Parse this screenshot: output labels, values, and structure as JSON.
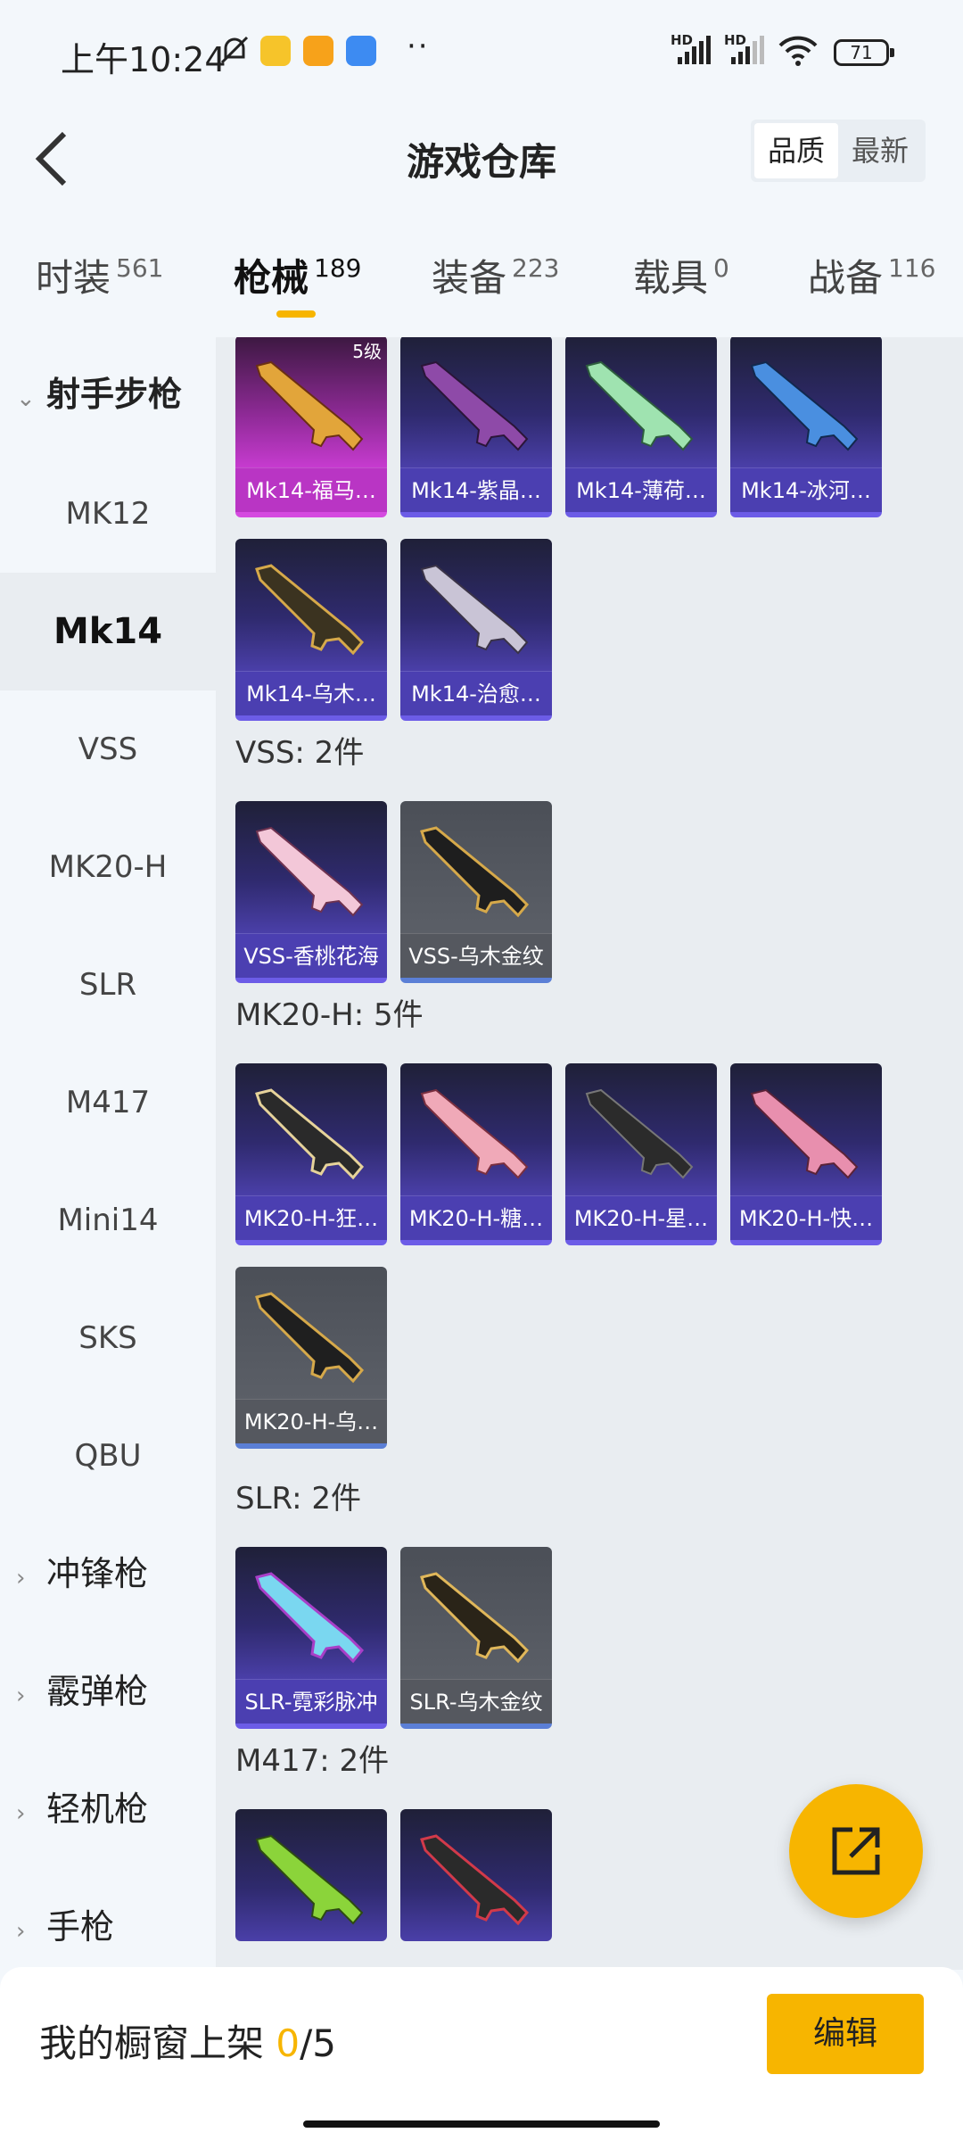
{
  "status": {
    "time": "上午10:24",
    "battery": "71",
    "dots": "··",
    "signal1_label": "HD",
    "signal2_label": "HD"
  },
  "header": {
    "title": "游戏仓库",
    "sort_quality": "品质",
    "sort_latest": "最新"
  },
  "tabs": [
    {
      "label": "时装",
      "count": "561"
    },
    {
      "label": "枪械",
      "count": "189"
    },
    {
      "label": "装备",
      "count": "223"
    },
    {
      "label": "载具",
      "count": "0"
    },
    {
      "label": "战备",
      "count": "116"
    }
  ],
  "sidebar": {
    "open_category": "射手步枪",
    "items": [
      "MK12",
      "Mk14",
      "VSS",
      "MK20-H",
      "SLR",
      "M417",
      "Mini14",
      "SKS",
      "QBU"
    ],
    "categories": [
      "冲锋枪",
      "霰弹枪",
      "轻机枪",
      "手枪"
    ]
  },
  "sections": {
    "mk14": {
      "cards": [
        "Mk14-福马…",
        "Mk14-紫晶…",
        "Mk14-薄荷…",
        "Mk14-冰河…",
        "Mk14-乌木…",
        "Mk14-治愈…"
      ],
      "level_tag": "5级"
    },
    "vss": {
      "label": "VSS: 2件",
      "cards": [
        "VSS-香桃花海",
        "VSS-乌木金纹"
      ]
    },
    "mk20": {
      "label": "MK20-H: 5件",
      "cards": [
        "MK20-H-狂…",
        "MK20-H-糖…",
        "MK20-H-星…",
        "MK20-H-快…",
        "MK20-H-乌…"
      ]
    },
    "slr": {
      "label": "SLR: 2件",
      "cards": [
        "SLR-霓彩脉冲",
        "SLR-乌木金纹"
      ]
    },
    "m417": {
      "label": "M417: 2件"
    }
  },
  "bottom": {
    "shelf_label": "我的橱窗上架 ",
    "shelf_current": "0",
    "shelf_total": "/5",
    "edit_label": "编辑"
  },
  "colors": {
    "accent": "#f7b500",
    "purple_rarity": "#4b3fb1",
    "gray_rarity": "#55585f",
    "pink_rarity": "#b935c4"
  }
}
